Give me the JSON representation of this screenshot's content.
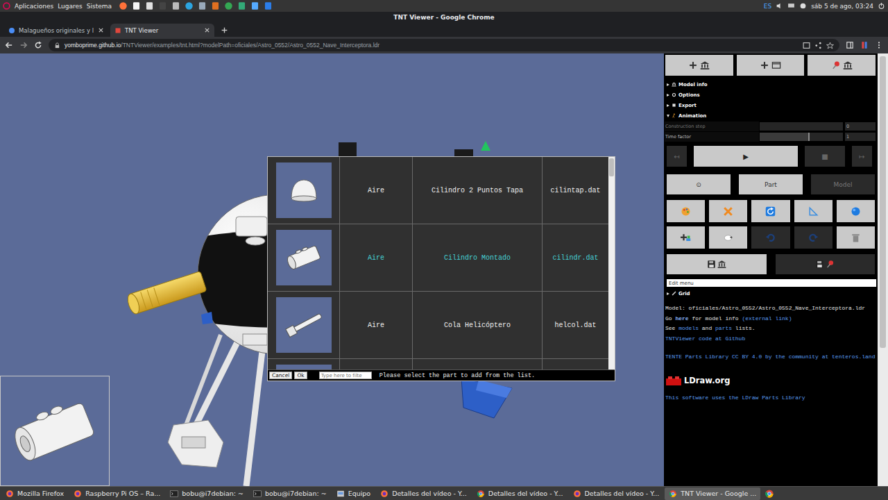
{
  "system_bar": {
    "menus": [
      "Aplicaciones",
      "Lugares",
      "Sistema"
    ],
    "keyboard": "ES",
    "clock": "sáb 5 de ago, 03:24"
  },
  "window": {
    "title": "TNT Viewer - Google Chrome"
  },
  "tabs": [
    {
      "label": "Malagueños originales y l",
      "selected": false
    },
    {
      "label": "TNT Viewer",
      "selected": true
    }
  ],
  "address_bar": {
    "host": "yomboprime.github.io",
    "path": "/TNTViewer/examples/tnt.html?modelPath=oficiales/Astro_0552/Astro_0552_Nave_Interceptora.ldr"
  },
  "part_dialog": {
    "rows": [
      {
        "category": "Aire",
        "name": "Cilindro 2 Puntos Tapa",
        "file": "cilintap.dat",
        "selected": false,
        "kind": "dome"
      },
      {
        "category": "Aire",
        "name": "Cilindro Montado",
        "file": "cilindr.dat",
        "selected": true,
        "kind": "cylinder"
      },
      {
        "category": "Aire",
        "name": "Cola Helicóptero",
        "file": "helcol.dat",
        "selected": false,
        "kind": "tail"
      }
    ],
    "buttons": [
      "Cancel",
      "Ok"
    ],
    "filter_placeholder": "Type here to filte",
    "message": "Please select the part to add from the list."
  },
  "side_panel": {
    "top_buttons": [
      {
        "kind": "add-library"
      },
      {
        "kind": "add-window"
      },
      {
        "kind": "pin-library"
      }
    ],
    "sections": [
      {
        "label": "Model info",
        "expanded": false,
        "kind": "bank"
      },
      {
        "label": "Options",
        "expanded": false,
        "kind": "gear"
      },
      {
        "label": "Export",
        "expanded": false,
        "kind": "export"
      },
      {
        "label": "Animation",
        "expanded": true,
        "kind": "runner"
      }
    ],
    "sliders": [
      {
        "label": "Construction step",
        "level": 0,
        "reading": "0",
        "disabled": true
      },
      {
        "label": "Time factor",
        "level": 0.6,
        "reading": "1",
        "disabled": false
      }
    ],
    "playback": [
      {
        "label": "↤",
        "disabled": true
      },
      {
        "label": "▶",
        "disabled": false
      },
      {
        "label": "■",
        "disabled": true
      },
      {
        "label": "↦",
        "disabled": true
      }
    ],
    "modes": [
      {
        "label": "⊙",
        "disabled": false
      },
      {
        "label": "Part",
        "disabled": false
      },
      {
        "label": "Model",
        "disabled": true
      }
    ],
    "tools": [
      {
        "kind": "palette",
        "disabled": false
      },
      {
        "kind": "shuffle",
        "disabled": false
      },
      {
        "kind": "rotate",
        "disabled": false
      },
      {
        "kind": "ruler",
        "disabled": false
      },
      {
        "kind": "sphere",
        "disabled": false
      },
      {
        "kind": "add-part",
        "disabled": false
      },
      {
        "kind": "sheep",
        "disabled": false
      },
      {
        "kind": "undo",
        "disabled": true
      },
      {
        "kind": "redo",
        "disabled": true
      },
      {
        "kind": "trash",
        "disabled": false
      }
    ],
    "save_buttons": [
      {
        "kind": "save-library",
        "disabled": false
      },
      {
        "kind": "save-pin",
        "disabled": true
      }
    ],
    "edit_menu": "Edit menu",
    "grid": {
      "label": "Grid",
      "expanded": false
    },
    "info_lines": [
      [
        {
          "text": "Model: oficiales/Astro_0552/Astro_0552_Nave_Interceptora.ldr",
          "link": false
        }
      ],
      [
        {
          "text": "Go ",
          "link": false
        },
        {
          "text": "here",
          "link": true
        },
        {
          "text": " for model info ",
          "link": false
        },
        {
          "text": "(external link)",
          "link": true
        }
      ],
      [
        {
          "text": "See ",
          "link": false
        },
        {
          "text": "models",
          "link": true
        },
        {
          "text": " and ",
          "link": false
        },
        {
          "text": "parts",
          "link": true
        },
        {
          "text": " lists.",
          "link": false
        }
      ],
      [
        {
          "text": "TNTViewer code at Github",
          "link": true
        }
      ]
    ],
    "license": "TENTE Parts Library CC BY 4.0 by the community at tenteros.land",
    "ldraw": {
      "logo": "LDraw.org",
      "note": "This software uses the LDraw Parts Library"
    }
  },
  "taskbar": [
    {
      "label": "Mozilla Firefox",
      "kind": "firefox",
      "active": false
    },
    {
      "label": "Raspberry Pi OS – Ra...",
      "kind": "firefox",
      "active": false
    },
    {
      "label": "bobu@i7debian: ~",
      "kind": "terminal",
      "active": false
    },
    {
      "label": "bobu@i7debian: ~",
      "kind": "terminal",
      "active": false
    },
    {
      "label": "Equipo",
      "kind": "files",
      "active": false
    },
    {
      "label": "Detalles del vídeo - Y...",
      "kind": "firefox",
      "active": false
    },
    {
      "label": "Detalles del vídeo - Y...",
      "kind": "chrome",
      "active": false
    },
    {
      "label": "Detalles del vídeo - Y...",
      "kind": "firefox",
      "active": false
    },
    {
      "label": "TNT Viewer - Google ...",
      "kind": "chrome",
      "active": true
    }
  ]
}
